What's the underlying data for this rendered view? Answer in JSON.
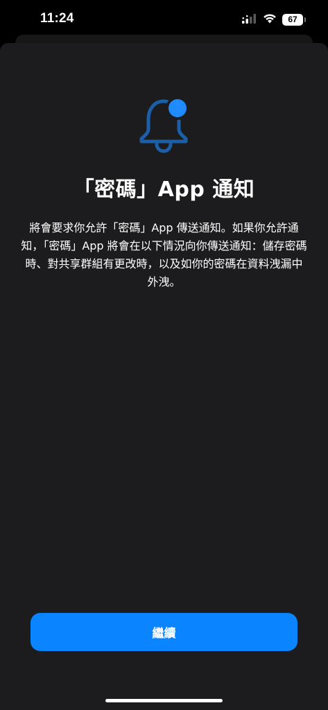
{
  "status_bar": {
    "time": "11:24",
    "battery_level": "67",
    "signal_icon": "cellular-signal-icon",
    "wifi_icon": "wifi-icon"
  },
  "dialog": {
    "icon": "bell-with-badge-icon",
    "title": "「密碼」App 通知",
    "body": "將會要求你允許「密碼」App 傳送通知。如果你允許通知，「密碼」App 將會在以下情況向你傳送通知：儲存密碼時、對共享群組有更改時，以及如你的密碼在資料洩漏中外洩。",
    "continue_label": "繼續"
  },
  "colors": {
    "accent": "#0a84ff",
    "icon_accent": "#1f8bff",
    "sheet_background": "#1c1c1e",
    "background": "#000000"
  }
}
